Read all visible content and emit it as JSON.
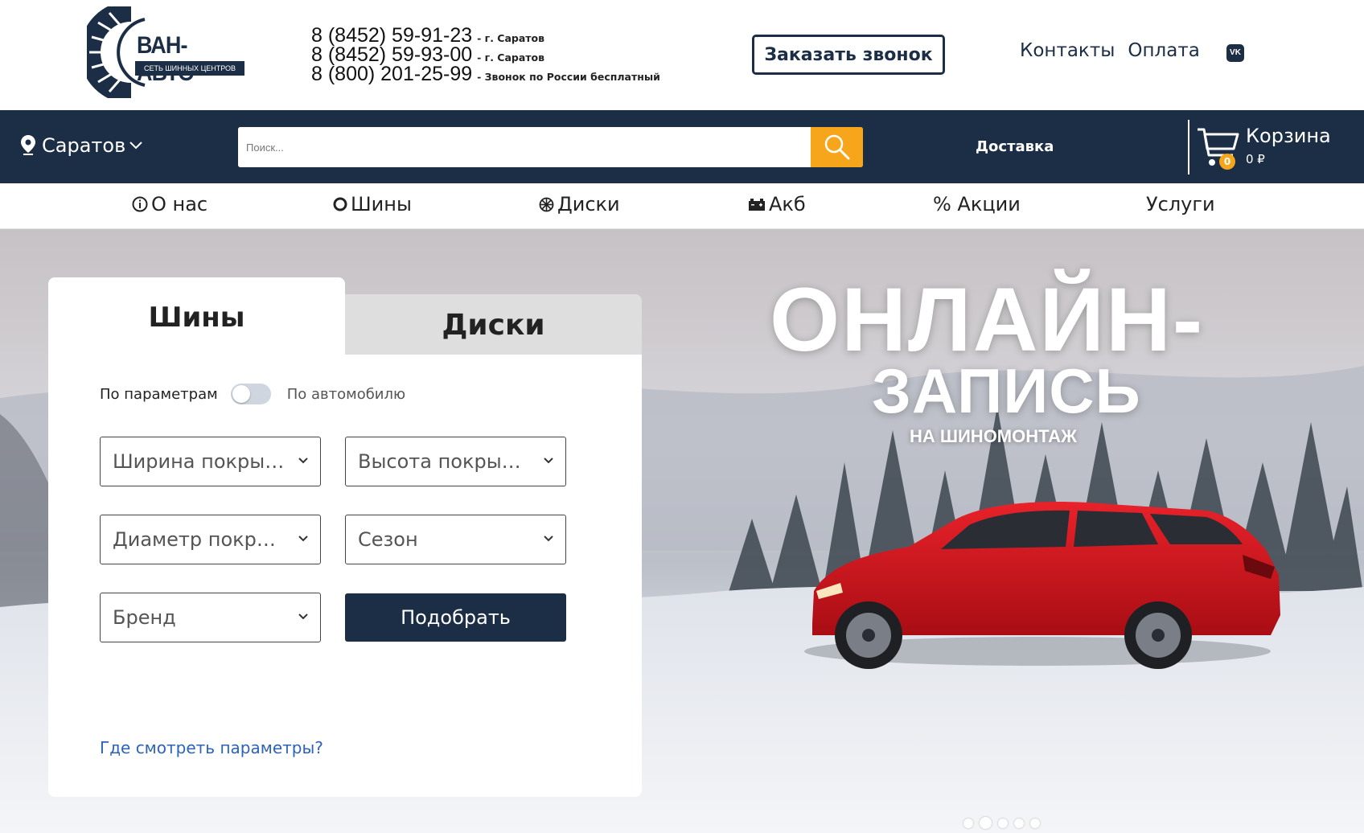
{
  "brand": {
    "name": "ВАН-АВТО",
    "tagline": "СЕТЬ ШИННЫХ ЦЕНТРОВ"
  },
  "phones": [
    {
      "number": "8 (8452) 59-91-23",
      "note": "- г. Саратов"
    },
    {
      "number": "8 (8452) 59-93-00",
      "note": "- г. Саратов"
    },
    {
      "number": "8 (800) 201-25-99",
      "note": "- Звонок по России бесплатный"
    }
  ],
  "header": {
    "callback_label": "Заказать звонок",
    "links": [
      "Контакты",
      "Оплата"
    ],
    "vk_label": "VK"
  },
  "navbar": {
    "city": "Саратов",
    "search_placeholder": "Поиск...",
    "delivery": "Доставка",
    "cart_label": "Корзина",
    "cart_count": "0",
    "cart_sum": "0 ₽"
  },
  "menu": {
    "items": [
      "О нас",
      "Шины",
      "Диски",
      "Акб",
      "% Акции",
      "Услуги"
    ]
  },
  "selector": {
    "tabs": [
      "Шины",
      "Диски"
    ],
    "active_tab": "Шины",
    "mode_left": "По параметрам",
    "mode_right": "По автомобилю",
    "fields": [
      "Ширина покрышки",
      "Высота покрышки",
      "Диаметр покрышки",
      "Сезон",
      "Бренд"
    ],
    "submit": "Подобрать",
    "help_link": "Где смотреть параметры?"
  },
  "hero": {
    "line1": "ОНЛАЙН-",
    "line2": "ЗАПИСЬ",
    "line3": "НА ШИНОМОНТАЖ",
    "slides": 5,
    "active_slide": 2
  },
  "colors": {
    "navy": "#1c2e45",
    "accent": "#f7a51b",
    "link": "#2c63b8",
    "car": "#d5161f"
  }
}
